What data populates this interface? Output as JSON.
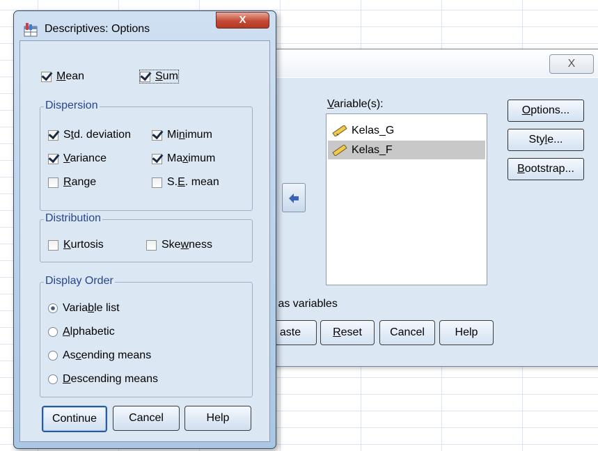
{
  "options_dialog": {
    "title": "Descriptives: Options",
    "close_label": "X",
    "mean": {
      "label_pre": "",
      "label_ul": "M",
      "label_post": "ean",
      "checked": true
    },
    "sum": {
      "label_pre": "",
      "label_ul": "S",
      "label_post": "um",
      "checked": true
    },
    "dispersion": {
      "title": "Dispersion",
      "std_deviation": {
        "label_pre": "S",
        "label_ul": "t",
        "label_post": "d. deviation",
        "checked": true
      },
      "minimum": {
        "label_pre": "Mi",
        "label_ul": "n",
        "label_post": "imum",
        "checked": true
      },
      "variance": {
        "label_pre": "",
        "label_ul": "V",
        "label_post": "ariance",
        "checked": true
      },
      "maximum": {
        "label_pre": "Ma",
        "label_ul": "x",
        "label_post": "imum",
        "checked": true
      },
      "range": {
        "label_pre": "",
        "label_ul": "R",
        "label_post": "ange",
        "checked": false
      },
      "se_mean": {
        "label_pre": "S.",
        "label_ul": "E",
        "label_post": ". mean",
        "checked": false
      }
    },
    "distribution": {
      "title": "Distribution",
      "kurtosis": {
        "label_pre": "",
        "label_ul": "K",
        "label_post": "urtosis",
        "checked": false
      },
      "skewness": {
        "label_pre": "Ske",
        "label_ul": "w",
        "label_post": "ness",
        "checked": false
      }
    },
    "display_order": {
      "title": "Display Order",
      "variable_list": {
        "label_pre": "Varia",
        "label_ul": "b",
        "label_post": "le list",
        "selected": true
      },
      "alphabetic": {
        "label_pre": "",
        "label_ul": "A",
        "label_post": "lphabetic",
        "selected": false
      },
      "ascending": {
        "label_pre": "As",
        "label_ul": "c",
        "label_post": "ending means",
        "selected": false
      },
      "descending": {
        "label_pre": "",
        "label_ul": "D",
        "label_post": "escending means",
        "selected": false
      }
    },
    "buttons": {
      "continue": "Continue",
      "cancel": "Cancel",
      "help": "Help"
    }
  },
  "descriptives_dialog": {
    "close_label": "X",
    "variables_label_ul": "V",
    "variables_label_post": "ariable(s):",
    "variables": [
      "Kelas_G",
      "Kelas_F"
    ],
    "selected_variable": "Kelas_F",
    "side_buttons": {
      "options_ul": "O",
      "options_post": "ptions...",
      "style_pre": "Sty",
      "style_ul": "l",
      "style_post": "e...",
      "bootstrap_ul": "B",
      "bootstrap_post": "ootstrap..."
    },
    "partial_text": "s as variables",
    "bottom_buttons": {
      "paste": "aste",
      "reset_ul": "R",
      "reset_post": "eset",
      "cancel": "Cancel",
      "help": "Help"
    }
  },
  "colors": {
    "dialog_body": "#dce7f4",
    "group_title": "#26468c",
    "close_red": "#c54a35",
    "selected_row": "#c8c8c8"
  }
}
